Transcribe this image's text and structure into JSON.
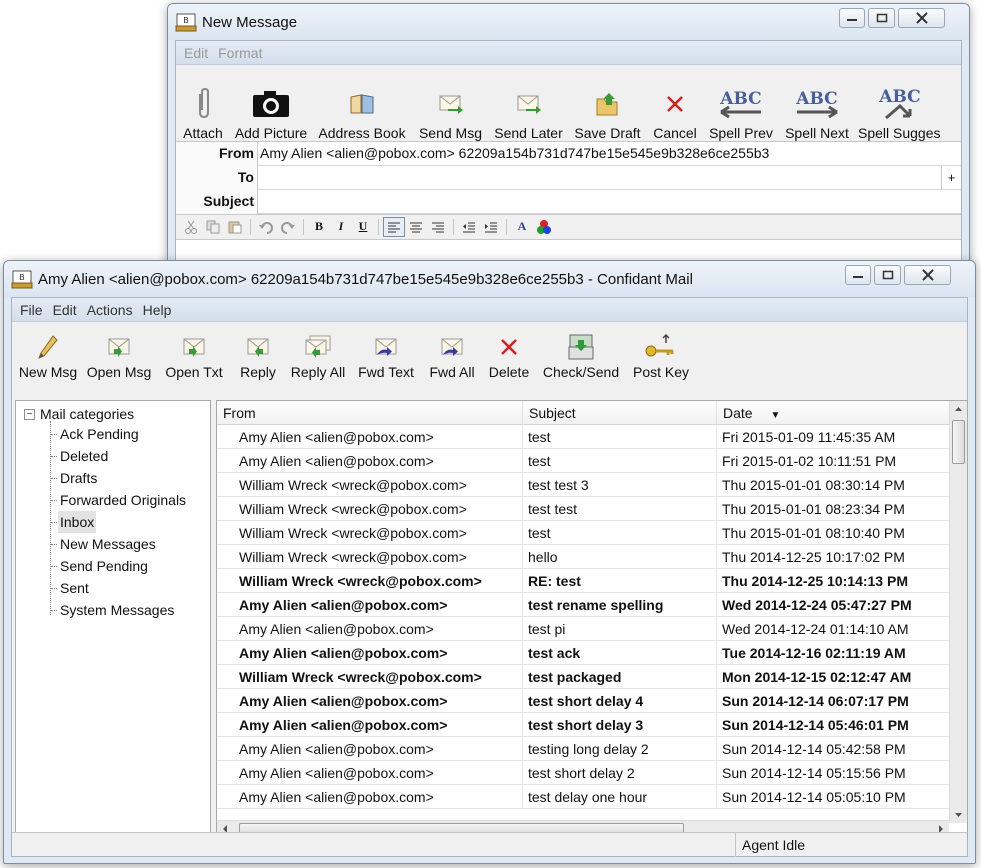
{
  "compose": {
    "title": "New Message",
    "menu": [
      "Edit",
      "Format"
    ],
    "toolbar": [
      {
        "label": "Attach",
        "icon": "paperclip-icon"
      },
      {
        "label": "Add Picture",
        "icon": "camera-icon"
      },
      {
        "label": "Address Book",
        "icon": "address-book-icon"
      },
      {
        "label": "Send Msg",
        "icon": "send-message-icon"
      },
      {
        "label": "Send Later",
        "icon": "send-later-icon"
      },
      {
        "label": "Save Draft",
        "icon": "save-draft-icon"
      },
      {
        "label": "Cancel",
        "icon": "cancel-icon"
      },
      {
        "label": "Spell Prev",
        "icon": "spell-prev-icon"
      },
      {
        "label": "Spell Next",
        "icon": "spell-next-icon"
      },
      {
        "label": "Spell Sugges",
        "icon": "spell-suggest-icon"
      }
    ],
    "headers": {
      "from_label": "From",
      "from_value": "Amy Alien <alien@pobox.com> 62209a154b731d747be15e545e9b328e6ce255b3",
      "to_label": "To",
      "to_value": "",
      "add_recipient": "+",
      "subject_label": "Subject",
      "subject_value": ""
    },
    "format_glyphs": {
      "bold": "B",
      "italic": "I",
      "underline": "U",
      "font_color": "A"
    }
  },
  "main": {
    "title": "Amy Alien <alien@pobox.com> 62209a154b731d747be15e545e9b328e6ce255b3 - Confidant Mail",
    "menu": [
      "File",
      "Edit",
      "Actions",
      "Help"
    ],
    "toolbar": [
      {
        "label": "New Msg",
        "icon": "pencil-icon"
      },
      {
        "label": "Open Msg",
        "icon": "open-message-icon"
      },
      {
        "label": "Open Txt",
        "icon": "open-text-icon"
      },
      {
        "label": "Reply",
        "icon": "reply-icon"
      },
      {
        "label": "Reply All",
        "icon": "reply-all-icon"
      },
      {
        "label": "Fwd Text",
        "icon": "forward-text-icon"
      },
      {
        "label": "Fwd All",
        "icon": "forward-all-icon"
      },
      {
        "label": "Delete",
        "icon": "delete-icon"
      },
      {
        "label": "Check/Send",
        "icon": "check-send-icon"
      },
      {
        "label": "Post Key",
        "icon": "key-icon"
      }
    ],
    "tree": {
      "root": "Mail categories",
      "root_toggle": "−",
      "items": [
        "Ack Pending",
        "Deleted",
        "Drafts",
        "Forwarded Originals",
        "Inbox",
        "New Messages",
        "Send Pending",
        "Sent",
        "System Messages"
      ],
      "selected": "Inbox"
    },
    "list": {
      "columns": {
        "from": "From",
        "subject": "Subject",
        "date": "Date",
        "sort_indicator": "▼"
      },
      "rows": [
        {
          "from": "Amy Alien <alien@pobox.com>",
          "subject": "test",
          "date": "Fri 2015-01-09 11:45:35 AM",
          "bold": false
        },
        {
          "from": "Amy Alien <alien@pobox.com>",
          "subject": "test",
          "date": "Fri 2015-01-02 10:11:51 PM",
          "bold": false
        },
        {
          "from": "William Wreck <wreck@pobox.com>",
          "subject": "test test 3",
          "date": "Thu 2015-01-01 08:30:14 PM",
          "bold": false
        },
        {
          "from": "William Wreck <wreck@pobox.com>",
          "subject": "test test",
          "date": "Thu 2015-01-01 08:23:34 PM",
          "bold": false
        },
        {
          "from": "William Wreck <wreck@pobox.com>",
          "subject": "test",
          "date": "Thu 2015-01-01 08:10:40 PM",
          "bold": false
        },
        {
          "from": "William Wreck <wreck@pobox.com>",
          "subject": "hello",
          "date": "Thu 2014-12-25 10:17:02 PM",
          "bold": false
        },
        {
          "from": "William Wreck <wreck@pobox.com>",
          "subject": "RE: test",
          "date": "Thu 2014-12-25 10:14:13 PM",
          "bold": true
        },
        {
          "from": "Amy Alien <alien@pobox.com>",
          "subject": "test rename spelling",
          "date": "Wed 2014-12-24 05:47:27 PM",
          "bold": true
        },
        {
          "from": "Amy Alien <alien@pobox.com>",
          "subject": "test pi",
          "date": "Wed 2014-12-24 01:14:10 AM",
          "bold": false
        },
        {
          "from": "Amy Alien <alien@pobox.com>",
          "subject": "test ack",
          "date": "Tue 2014-12-16 02:11:19 AM",
          "bold": true
        },
        {
          "from": "William Wreck <wreck@pobox.com>",
          "subject": "test packaged",
          "date": "Mon 2014-12-15 02:12:47 AM",
          "bold": true
        },
        {
          "from": "Amy Alien <alien@pobox.com>",
          "subject": "test short delay 4",
          "date": "Sun 2014-12-14 06:07:17 PM",
          "bold": true
        },
        {
          "from": "Amy Alien <alien@pobox.com>",
          "subject": "test short delay 3",
          "date": "Sun 2014-12-14 05:46:01 PM",
          "bold": true
        },
        {
          "from": "Amy Alien <alien@pobox.com>",
          "subject": "testing long delay 2",
          "date": "Sun 2014-12-14 05:42:58 PM",
          "bold": false
        },
        {
          "from": "Amy Alien <alien@pobox.com>",
          "subject": "test short delay 2",
          "date": "Sun 2014-12-14 05:15:56 PM",
          "bold": false
        },
        {
          "from": "Amy Alien <alien@pobox.com>",
          "subject": "test delay one hour",
          "date": "Sun 2014-12-14 05:05:10 PM",
          "bold": false
        }
      ]
    },
    "status": {
      "left": "",
      "right": "Agent Idle"
    }
  }
}
